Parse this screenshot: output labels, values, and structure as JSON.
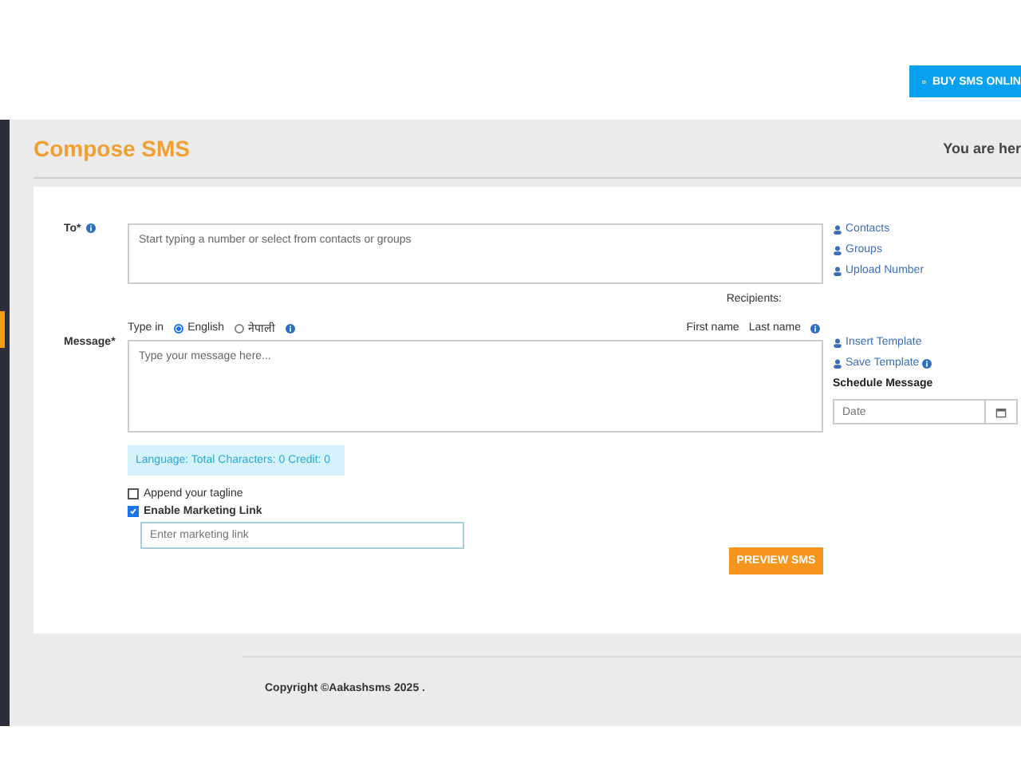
{
  "top_bar": {
    "buy_button": "BUY SMS ONLIN"
  },
  "sidebar": {
    "items": [
      {
        "selected": true
      }
    ]
  },
  "header": {
    "title": "Compose SMS",
    "breadcrumb": "You are her"
  },
  "form": {
    "to": {
      "label": "To*",
      "placeholder": "Start typing a number or select from contacts or groups"
    },
    "to_links": [
      "Contacts",
      "Groups",
      "Upload Number"
    ],
    "recipients": "Recipients:",
    "type_in": {
      "label": "Type in",
      "options": [
        {
          "label": "English",
          "selected": true
        },
        {
          "label": "नेपाली",
          "selected": false
        }
      ]
    },
    "fields": [
      "First name",
      "Last name"
    ],
    "message": {
      "label": "Message*",
      "placeholder": "Type your message here..."
    },
    "template_links": [
      "Insert Template",
      "Save Template"
    ],
    "schedule": {
      "label": "Schedule Message",
      "placeholder": "Date"
    },
    "info": "Language: Total Characters: 0 Credit: 0",
    "options": [
      {
        "label": "Append your tagline",
        "checked": false
      },
      {
        "label": "Enable Marketing Link",
        "checked": true
      }
    ],
    "marketing_link": {
      "placeholder": "Enter marketing link"
    },
    "preview_button": "PREVIEW SMS"
  },
  "footer": {
    "copyright": "Copyright ©Aakashsms 2025 ."
  }
}
